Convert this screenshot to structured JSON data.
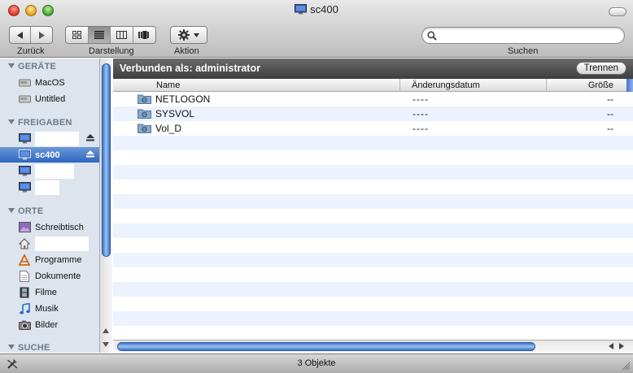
{
  "window": {
    "title": "sc400"
  },
  "toolbar": {
    "back_label": "Zurück",
    "view_label": "Darstellung",
    "action_label": "Aktion",
    "search_label": "Suchen",
    "search_value": ""
  },
  "sidebar": {
    "devices_header": "GERÄTE",
    "devices": [
      {
        "label": "MacOS"
      },
      {
        "label": "Untitled"
      }
    ],
    "shares_header": "FREIGABEN",
    "shares": [
      {
        "label": ""
      },
      {
        "label": "sc400"
      },
      {
        "label": ""
      },
      {
        "label": ""
      }
    ],
    "places_header": "ORTE",
    "places": [
      {
        "label": "Schreibtisch"
      },
      {
        "label": ""
      },
      {
        "label": "Programme"
      },
      {
        "label": "Dokumente"
      },
      {
        "label": "Filme"
      },
      {
        "label": "Musik"
      },
      {
        "label": "Bilder"
      }
    ],
    "search_header": "SUCHE"
  },
  "connection": {
    "text": "Verbunden als: administrator",
    "disconnect_label": "Trennen"
  },
  "columns": {
    "name": "Name",
    "modified": "Änderungsdatum",
    "size": "Größe"
  },
  "files": [
    {
      "name": "NETLOGON",
      "modified": "----",
      "size": "--"
    },
    {
      "name": "SYSVOL",
      "modified": "----",
      "size": "--"
    },
    {
      "name": "Vol_D",
      "modified": "----",
      "size": "--"
    }
  ],
  "status": {
    "text": "3 Objekte"
  },
  "colors": {
    "selection": "#2d66bf",
    "sidebar_bg": "#dde4ed",
    "row_alt": "#edf3fe"
  }
}
